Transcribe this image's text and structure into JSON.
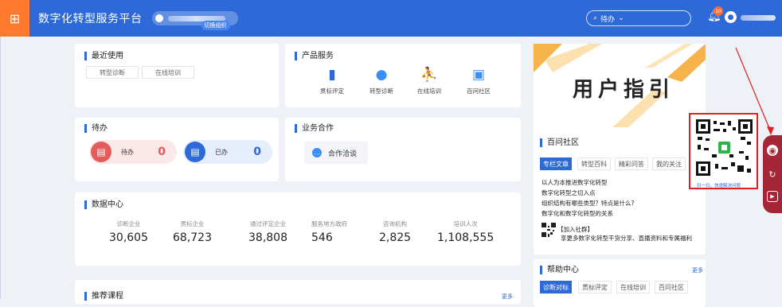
{
  "header": {
    "app_title": "数字化转型服务平台",
    "switch_tag": "切换组织",
    "search": {
      "value": "待办",
      "icon": "search-icon"
    },
    "bell_badge": "10"
  },
  "recent": {
    "title": "最近使用",
    "items": [
      "转型诊断",
      "在线培训"
    ]
  },
  "products": {
    "title": "产品服务",
    "items": [
      {
        "label": "贯标评定",
        "icon": "building-icon",
        "color": "#2d6ad8"
      },
      {
        "label": "转型诊断",
        "icon": "magnifier-icon",
        "color": "#3a8ff7"
      },
      {
        "label": "在线培训",
        "icon": "runner-icon",
        "color": "#f39c12"
      },
      {
        "label": "百问社区",
        "icon": "frame-icon",
        "color": "#3a8ff7"
      }
    ]
  },
  "todo": {
    "title": "待办",
    "pending": {
      "label": "待办",
      "count": "0",
      "color": "#e35b5b"
    },
    "done": {
      "label": "已办",
      "count": "0",
      "color": "#2d6ad8"
    }
  },
  "business": {
    "title": "业务合作",
    "item": "合作洽谈"
  },
  "data_center": {
    "title": "数据中心",
    "stats": [
      {
        "label": "诊断企业",
        "value": "30,605"
      },
      {
        "label": "贯标企业",
        "value": "68,723"
      },
      {
        "label": "通过评定企业",
        "value": "38,808"
      },
      {
        "label": "服务地方政府",
        "value": "546"
      },
      {
        "label": "咨询机构",
        "value": "2,825"
      },
      {
        "label": "培训人次",
        "value": "1,108,555"
      }
    ]
  },
  "courses": {
    "title": "推荐课程",
    "more": "更多"
  },
  "guide_banner": {
    "title": "用户指引"
  },
  "community": {
    "title": "百问社区",
    "tabs": [
      "专栏文章",
      "转型百科",
      "精彩问答",
      "我的关注"
    ],
    "links": [
      "以人为本推进数字化转型",
      "数字化转型之切入点",
      "组织结构有哪些类型？特点是什么?",
      "数字化和数字化转型的关系"
    ],
    "join": "【加入社群】",
    "join_desc": "享更多数字化转型干货分享、直播资料和专属福利"
  },
  "help_center": {
    "title": "帮助中心",
    "more": "更多",
    "tabs": [
      "诊断对标",
      "贯标评定",
      "在线培训",
      "百问社区"
    ]
  },
  "qr_popup": {
    "caption": "扫一扫，快速解决问题"
  }
}
